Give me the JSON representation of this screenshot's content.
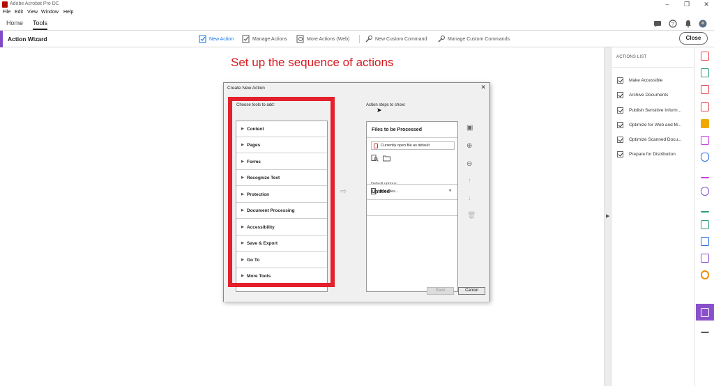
{
  "window": {
    "title": "Adobe Acrobat Pro DC",
    "controls": [
      "–",
      "❐",
      "✕"
    ]
  },
  "menu": [
    "File",
    "Edit",
    "View",
    "Window",
    "Help"
  ],
  "nav": {
    "tabs": [
      {
        "label": "Home"
      },
      {
        "label": "Tools"
      }
    ],
    "active_tab": "Tools"
  },
  "toolbar": {
    "wizard_label": "Action Wizard",
    "items": [
      {
        "label": "New Action",
        "icon": "new-action-icon"
      },
      {
        "label": "Manage Actions",
        "icon": "manage-actions-icon"
      },
      {
        "label": "More Actions (Web)",
        "icon": "more-actions-icon"
      },
      {
        "label": "New Custom Command",
        "icon": "new-custom-command-icon"
      },
      {
        "label": "Manage Custom Commands",
        "icon": "manage-custom-commands-icon"
      }
    ],
    "close_label": "Close"
  },
  "headline": "Set up the sequence of actions",
  "dialog": {
    "title": "Create New Action",
    "close_glyph": "✕",
    "choose_label": "Choose tools to add:",
    "steps_label": "Action steps to show:",
    "tools": [
      {
        "label": "Content"
      },
      {
        "label": "Pages"
      },
      {
        "label": "Forms"
      },
      {
        "label": "Recognize Text"
      },
      {
        "label": "Protection"
      },
      {
        "label": "Document Processing"
      },
      {
        "label": "Accessibility"
      },
      {
        "label": "Save & Export"
      },
      {
        "label": "Go To"
      },
      {
        "label": "More Tools"
      }
    ],
    "files_header": "Files to be Processed",
    "open_file_option": "Currently open file as default",
    "default_options_label": "Default options:",
    "add_files_label": "Add Files...",
    "untitled_label": "Untitled",
    "save_label": "Save",
    "cancel_label": "Cancel"
  },
  "actions_list": {
    "header": "ACTIONS LIST",
    "items": [
      {
        "label": "Make Accessible",
        "checked": true
      },
      {
        "label": "Archive Documents",
        "checked": true
      },
      {
        "label": "Publish Sensitive Inform...",
        "checked": true
      },
      {
        "label": "Optimize for Web and M...",
        "checked": true
      },
      {
        "label": "Optimize Scanned Docu...",
        "checked": true
      },
      {
        "label": "Prepare for Distribution",
        "checked": true
      }
    ]
  },
  "colors": {
    "accent_purple": "#7f49c7",
    "highlight_red": "#e3202b",
    "link_blue": "#1473e6"
  }
}
